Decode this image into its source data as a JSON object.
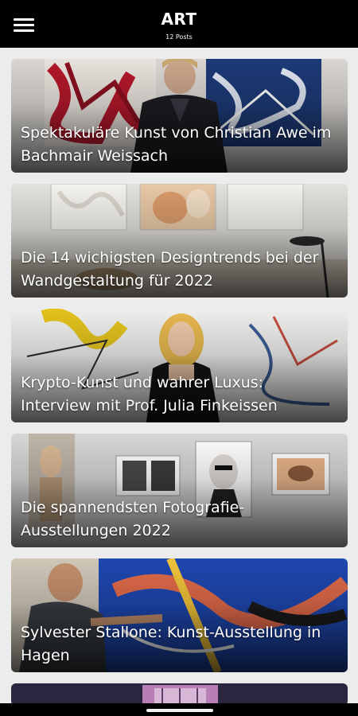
{
  "header": {
    "title": "ART",
    "subtitle": "12 Posts",
    "menu_icon": "hamburger-menu-icon"
  },
  "posts": [
    {
      "title": "Spektakuläre Kunst von Christian Awe im Bachmair Weissach"
    },
    {
      "title": "Die 14 wichigsten Designtrends bei der Wandgestaltung für 2022"
    },
    {
      "title": "Krypto-Kunst und wahrer Luxus: Interview mit Prof. Julia Finkeissen"
    },
    {
      "title": "Die spannendsten Fotografie-Ausstellungen 2022"
    },
    {
      "title": "Sylvester Stallone: Kunst-Ausstellung in Hagen"
    }
  ],
  "colors": {
    "topbar": "#000000",
    "background": "#ececec",
    "caption_text": "#ffffff"
  }
}
